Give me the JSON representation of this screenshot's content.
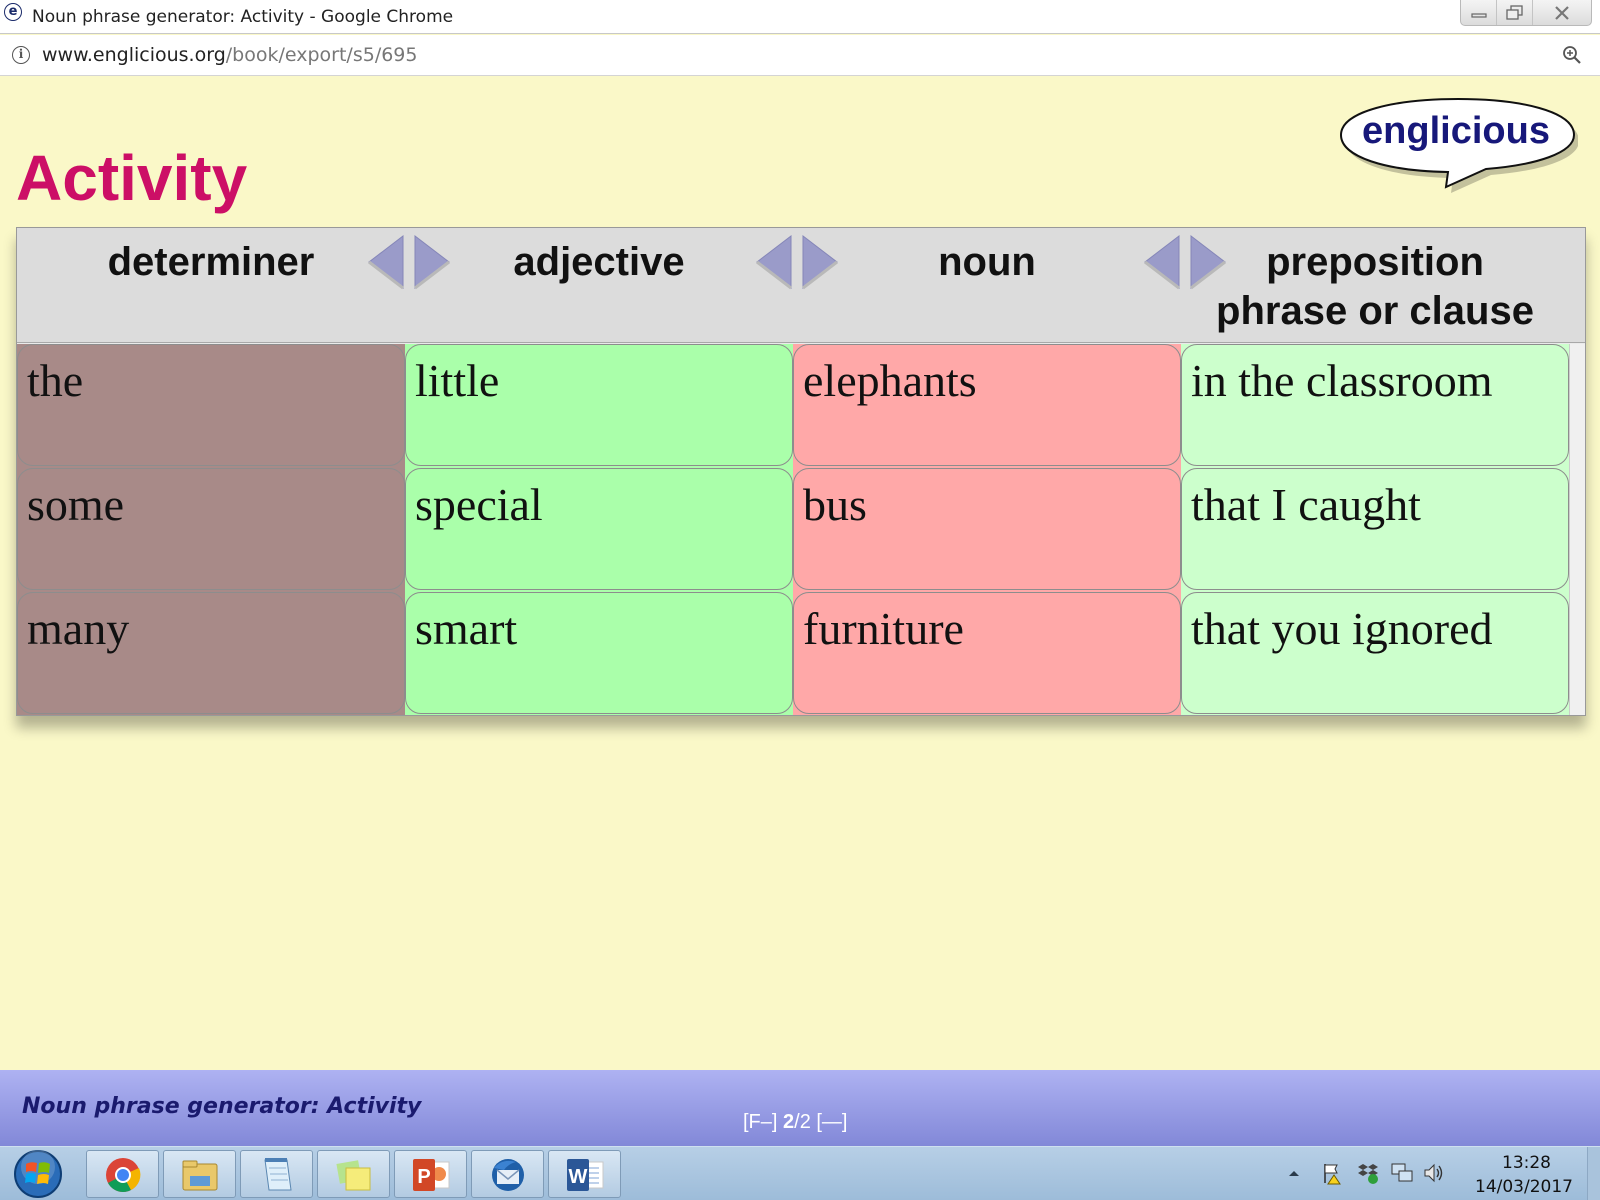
{
  "window": {
    "title": "Noun phrase generator: Activity - Google Chrome",
    "app_icon_glyph": "e",
    "controls": [
      "minimize-icon",
      "restore-icon",
      "close-icon"
    ]
  },
  "address_bar": {
    "url_host": "www.englicious.org",
    "url_path": "/book/export/s5/695"
  },
  "logo": {
    "text": "englicious"
  },
  "page": {
    "title": "Activity"
  },
  "table": {
    "columns": [
      {
        "header": "determiner",
        "color": "#a88a88",
        "cells": [
          "the",
          "some",
          "many"
        ]
      },
      {
        "header": "adjective",
        "color": "#aaffaa",
        "cells": [
          "little",
          "special",
          "smart"
        ]
      },
      {
        "header": "noun",
        "color": "#ffa8a8",
        "cells": [
          "elephants",
          "bus",
          "furniture"
        ]
      },
      {
        "header_line1": "preposition",
        "header_line2": "phrase or clause",
        "color": "#ccffcc",
        "cells": [
          "in the classroom",
          "that I caught",
          "that you ignored"
        ]
      }
    ]
  },
  "status_bar": {
    "title": "Noun phrase generator: Activity",
    "pager_prefix": "[F–] ",
    "pager_current": "2",
    "pager_suffix": "/2 [—]"
  },
  "taskbar": {
    "apps": [
      "chrome-icon",
      "file-explorer-icon",
      "notepad-icon",
      "sticky-notes-icon",
      "powerpoint-icon",
      "thunderbird-icon",
      "word-icon"
    ],
    "tray_icons": [
      "show-hidden-icons-icon",
      "action-center-flag-icon",
      "dropbox-icon",
      "network-icon",
      "volume-icon"
    ],
    "clock_time": "13:28",
    "clock_date": "14/03/2017"
  },
  "colors": {
    "page_background": "#faf8c8",
    "title_magenta": "#cc0f66",
    "logo_navy": "#17187a",
    "status_bar": "#9ea2ea"
  }
}
